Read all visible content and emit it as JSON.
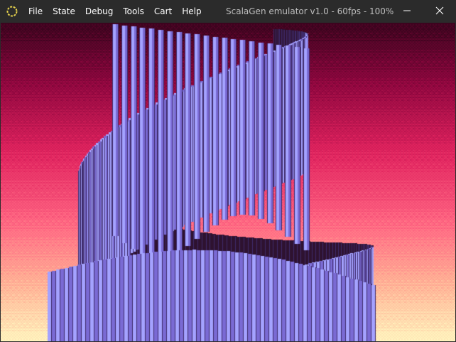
{
  "window": {
    "title": "ScalaGen emulator v1.0 - 60fps - 100%",
    "app_icon": "ring-icon",
    "minimize_icon": "minimize-icon",
    "close_icon": "close-icon"
  },
  "menu": {
    "items": [
      {
        "label": "File"
      },
      {
        "label": "State"
      },
      {
        "label": "Debug"
      },
      {
        "label": "Tools"
      },
      {
        "label": "Cart"
      },
      {
        "label": "Help"
      }
    ]
  },
  "colors": {
    "titlebar": "#2b2b2b",
    "title_text": "#bdbdbd",
    "menu_text": "#ffffff",
    "icon_ring": "#e8d44d",
    "sky_top": "#4a0624",
    "sky_mid": "#e0225e",
    "sky_low": "#ff9a8a",
    "sky_bottom": "#fff2bc",
    "ribbon_light": "#a4a2ff",
    "ribbon_mid": "#7a6ad4",
    "ribbon_dark": "#3e2a6a",
    "ribbon_back": "#2e1230"
  }
}
